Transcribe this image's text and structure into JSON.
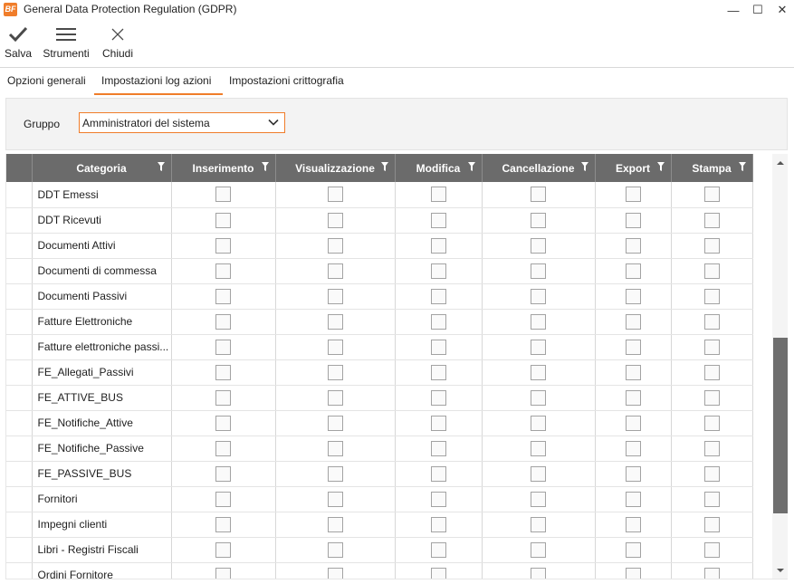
{
  "window": {
    "logo_text": "BF",
    "title": "General Data Protection Regulation (GDPR)",
    "minimize_glyph": "—",
    "maximize_glyph": "☐",
    "close_glyph": "✕"
  },
  "toolbar": {
    "save_label": "Salva",
    "tools_label": "Strumenti",
    "close_label": "Chiudi"
  },
  "tabs": [
    {
      "label": "Opzioni generali",
      "active": false
    },
    {
      "label": "Impostazioni log azioni",
      "active": true
    },
    {
      "label": "Impostazioni crittografia",
      "active": false
    }
  ],
  "group": {
    "label": "Gruppo",
    "selected": "Amministratori del sistema"
  },
  "grid": {
    "columns": [
      "Categoria",
      "Inserimento",
      "Visualizzazione",
      "Modifica",
      "Cancellazione",
      "Export",
      "Stampa"
    ],
    "rows": [
      {
        "categoria": "DDT Emessi",
        "checks": [
          false,
          false,
          false,
          false,
          false,
          false
        ]
      },
      {
        "categoria": "DDT Ricevuti",
        "checks": [
          false,
          false,
          false,
          false,
          false,
          false
        ]
      },
      {
        "categoria": "Documenti Attivi",
        "checks": [
          false,
          false,
          false,
          false,
          false,
          false
        ]
      },
      {
        "categoria": "Documenti di commessa",
        "checks": [
          false,
          false,
          false,
          false,
          false,
          false
        ]
      },
      {
        "categoria": "Documenti Passivi",
        "checks": [
          false,
          false,
          false,
          false,
          false,
          false
        ]
      },
      {
        "categoria": "Fatture Elettroniche",
        "checks": [
          false,
          false,
          false,
          false,
          false,
          false
        ]
      },
      {
        "categoria": "Fatture elettroniche passi...",
        "checks": [
          false,
          false,
          false,
          false,
          false,
          false
        ]
      },
      {
        "categoria": "FE_Allegati_Passivi",
        "checks": [
          false,
          false,
          false,
          false,
          false,
          false
        ]
      },
      {
        "categoria": "FE_ATTIVE_BUS",
        "checks": [
          false,
          false,
          false,
          false,
          false,
          false
        ]
      },
      {
        "categoria": "FE_Notifiche_Attive",
        "checks": [
          false,
          false,
          false,
          false,
          false,
          false
        ]
      },
      {
        "categoria": "FE_Notifiche_Passive",
        "checks": [
          false,
          false,
          false,
          false,
          false,
          false
        ]
      },
      {
        "categoria": "FE_PASSIVE_BUS",
        "checks": [
          false,
          false,
          false,
          false,
          false,
          false
        ]
      },
      {
        "categoria": "Fornitori",
        "checks": [
          false,
          false,
          false,
          false,
          false,
          false
        ]
      },
      {
        "categoria": "Impegni clienti",
        "checks": [
          false,
          false,
          false,
          false,
          false,
          false
        ]
      },
      {
        "categoria": "Libri - Registri Fiscali",
        "checks": [
          false,
          false,
          false,
          false,
          false,
          false
        ]
      },
      {
        "categoria": "Ordini Fornitore",
        "checks": [
          false,
          false,
          false,
          false,
          false,
          false
        ]
      }
    ]
  },
  "colors": {
    "accent": "#f07d2a",
    "header_bg": "#6b6b6b",
    "scroll_thumb": "#6e6e6e"
  }
}
